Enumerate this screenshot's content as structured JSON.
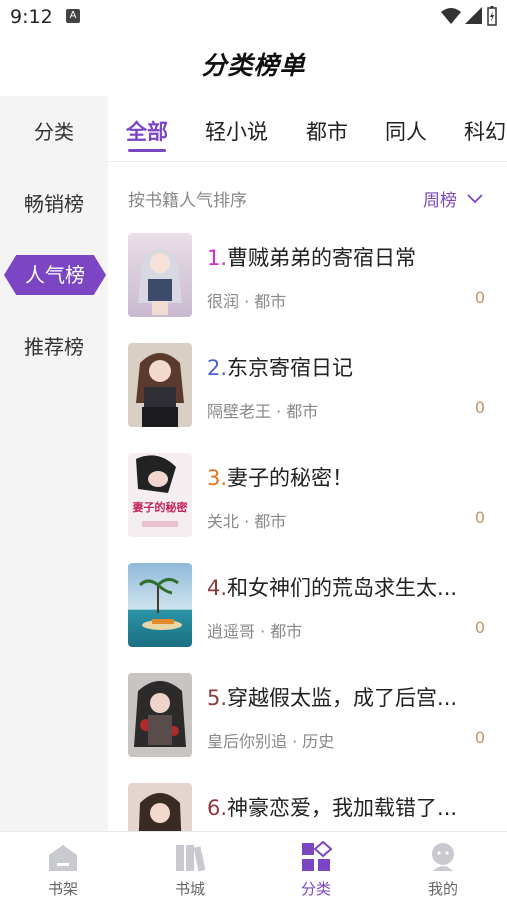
{
  "status": {
    "time": "9:12",
    "notif_badge": "A"
  },
  "app": {
    "title": "分类榜单"
  },
  "sidebar": {
    "items": [
      {
        "label": "分类"
      },
      {
        "label": "畅销榜"
      },
      {
        "label": "人气榜"
      },
      {
        "label": "推荐榜"
      }
    ],
    "active_index": 2
  },
  "tabs": [
    {
      "label": "全部"
    },
    {
      "label": "轻小说"
    },
    {
      "label": "都市"
    },
    {
      "label": "同人"
    },
    {
      "label": "科幻"
    }
  ],
  "sort": {
    "label": "按书籍人气排序",
    "period": "周榜"
  },
  "books": [
    {
      "rank": "1.",
      "rank_color": "#d12ad1",
      "title": "曹贼弟弟的寄宿日常",
      "author": "很润",
      "category": "都市",
      "count": "0"
    },
    {
      "rank": "2.",
      "rank_color": "#4a5fd6",
      "title": "东京寄宿日记",
      "author": "隔壁老王",
      "category": "都市",
      "count": "0"
    },
    {
      "rank": "3.",
      "rank_color": "#e8701e",
      "title": "妻子的秘密！",
      "author": "关北",
      "category": "都市",
      "count": "0"
    },
    {
      "rank": "4.",
      "rank_color": "#8f3a3a",
      "title": "和女神们的荒岛求生太...",
      "author": "逍遥哥",
      "category": "都市",
      "count": "0"
    },
    {
      "rank": "5.",
      "rank_color": "#8f3a3a",
      "title": "穿越假太监，成了后宫...",
      "author": "皇后你别追",
      "category": "历史",
      "count": "0"
    },
    {
      "rank": "6.",
      "rank_color": "#8f3a3a",
      "title": "神豪恋爱，我加载错了...",
      "author": "",
      "category": "",
      "count": ""
    }
  ],
  "cover3_text": "妻子的秘密",
  "nav": {
    "items": [
      {
        "label": "书架",
        "icon": "bookshelf-icon"
      },
      {
        "label": "书城",
        "icon": "bookstore-icon"
      },
      {
        "label": "分类",
        "icon": "category-icon"
      },
      {
        "label": "我的",
        "icon": "profile-icon"
      }
    ],
    "active_index": 2
  },
  "colors": {
    "accent": "#7b45c4",
    "count": "#c8916b"
  }
}
